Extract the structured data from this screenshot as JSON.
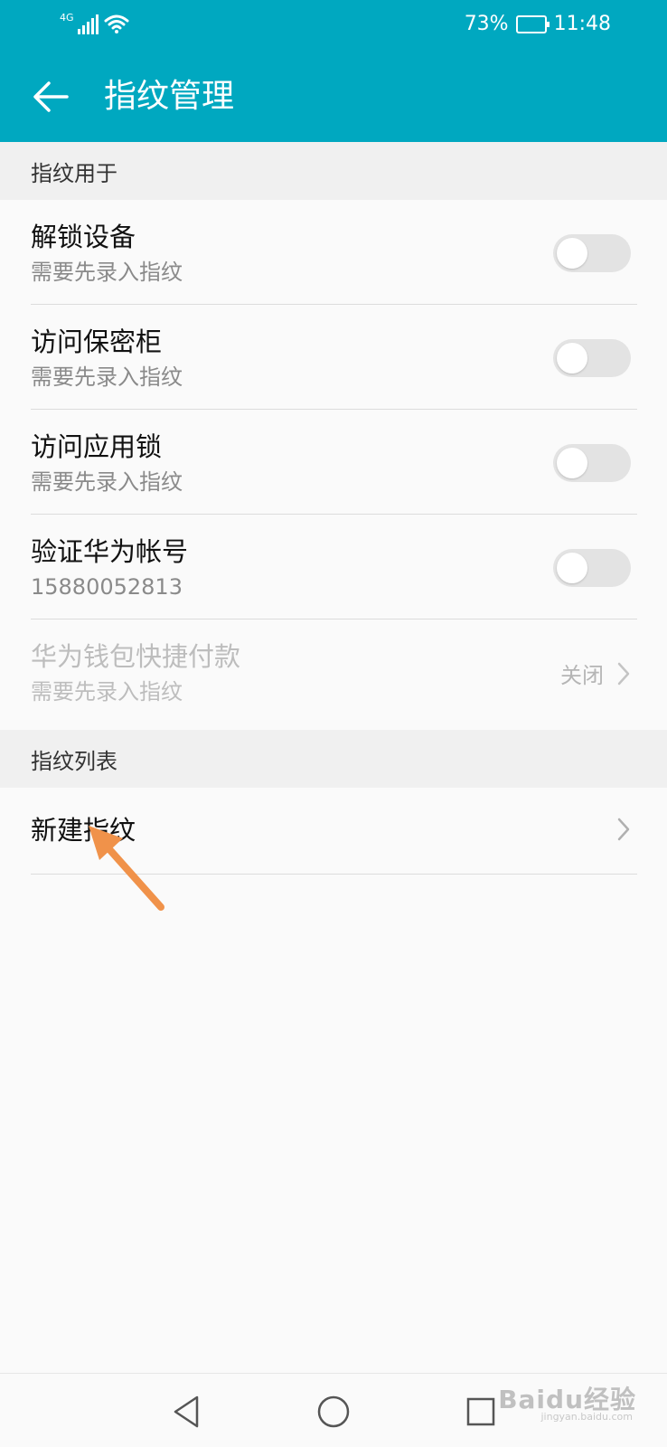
{
  "status_bar": {
    "network": "4G",
    "battery_percent": "73%",
    "battery_level": 0.73,
    "time": "11:48"
  },
  "toolbar": {
    "title": "指纹管理",
    "back_icon": "arrow-left-icon"
  },
  "section_usage": {
    "header": "指纹用于",
    "items": [
      {
        "title": "解锁设备",
        "subtitle": "需要先录入指纹",
        "toggle_on": false
      },
      {
        "title": "访问保密柜",
        "subtitle": "需要先录入指纹",
        "toggle_on": false
      },
      {
        "title": "访问应用锁",
        "subtitle": "需要先录入指纹",
        "toggle_on": false
      },
      {
        "title": "验证华为帐号",
        "subtitle": "15880052813",
        "toggle_on": false
      },
      {
        "title": "华为钱包快捷付款",
        "subtitle": "需要先录入指纹",
        "value": "关闭",
        "disabled": true
      }
    ]
  },
  "section_list": {
    "header": "指纹列表",
    "new_item": "新建指纹"
  },
  "annotation": {
    "color": "#f0924a"
  },
  "nav_bar": {
    "back_icon": "triangle-back-icon",
    "home_icon": "circle-home-icon",
    "recents_icon": "square-recents-icon"
  },
  "watermark": {
    "brand": "Baidu经验",
    "url": "jingyan.baidu.com"
  },
  "colors": {
    "accent": "#00a8c0",
    "section_bg": "#f0f0f0",
    "page_bg": "#fafafa"
  }
}
